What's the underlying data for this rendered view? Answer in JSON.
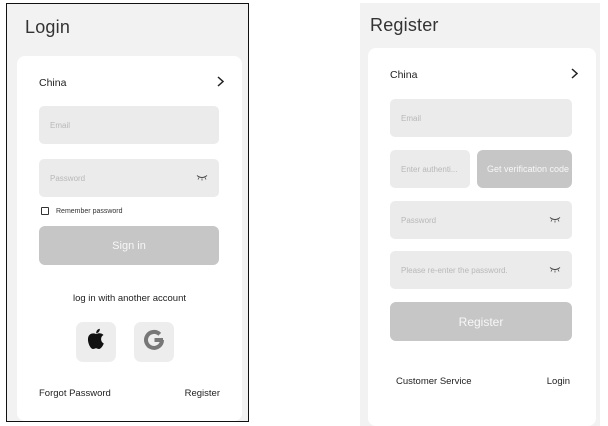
{
  "login": {
    "title": "Login",
    "country": "China",
    "email_placeholder": "Email",
    "password_placeholder": "Password",
    "remember_label": "Remember password",
    "sign_in_label": "Sign in",
    "alt_login_label": "log in with another account",
    "social_icons": [
      "apple-icon",
      "google-icon"
    ],
    "forgot_password_label": "Forgot Password",
    "register_label": "Register"
  },
  "register": {
    "title": "Register",
    "country": "China",
    "email_placeholder": "Email",
    "code_placeholder": "Enter authenti...",
    "get_code_label": "Get verification code",
    "password_placeholder": "Password",
    "confirm_placeholder": "Please re-enter the password.",
    "register_button_label": "Register",
    "customer_service_label": "Customer Service",
    "login_label": "Login"
  },
  "colors": {
    "background": "#f2f2f2",
    "card": "#ffffff",
    "field": "#ebebeb",
    "button_disabled": "#c6c6c6"
  }
}
